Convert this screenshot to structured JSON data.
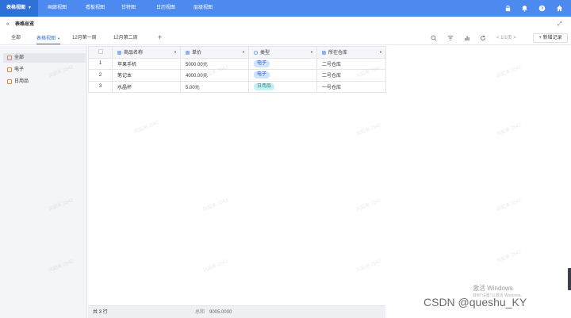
{
  "nav": {
    "items": [
      {
        "label": "表格视图",
        "active": true
      },
      {
        "label": "画廊视图",
        "active": false
      },
      {
        "label": "看板视图",
        "active": false
      },
      {
        "label": "甘特图",
        "active": false
      },
      {
        "label": "日历视图",
        "active": false
      },
      {
        "label": "层级视图",
        "active": false
      }
    ],
    "icons": [
      "lock-icon",
      "bell-icon",
      "help-icon",
      "home-icon"
    ]
  },
  "header": {
    "title": "表格总览"
  },
  "tabs": [
    {
      "label": "全部",
      "active": false
    },
    {
      "label": "表格视图",
      "active": true
    },
    {
      "label": "12月第一周",
      "active": false
    },
    {
      "label": "12月第二周",
      "active": false
    }
  ],
  "toolbar": {
    "pager": "< 1/1页 >",
    "add_record": "+ 新增记录"
  },
  "sidebar": {
    "items": [
      {
        "label": "全部",
        "active": true
      },
      {
        "label": "电子",
        "active": false
      },
      {
        "label": "日用品",
        "active": false
      }
    ]
  },
  "table": {
    "columns": [
      "商品名称",
      "单价",
      "类型",
      "所在仓库"
    ],
    "rows": [
      {
        "index": "1",
        "name": "苹果手机",
        "price": "5000.00元",
        "type": "电子",
        "warehouse": "二号仓库"
      },
      {
        "index": "2",
        "name": "笔记本",
        "price": "4000.00元",
        "type": "电子",
        "warehouse": "二号仓库"
      },
      {
        "index": "3",
        "name": "水晶杯",
        "price": "5.00元",
        "type": "日用品",
        "warehouse": "一号仓库"
      }
    ]
  },
  "footer": {
    "rows_label": "共 3 行",
    "sum_label": "总和",
    "sum_value": "9005.0000"
  },
  "overlay": {
    "activate": "激活 Windows",
    "activate_sub": "转到\"设置\"以激活 Windows。",
    "csdn": "CSDN @queshu_KY",
    "watermark": "风起来 2542"
  },
  "colors": {
    "nav_bg": "#4d8af0",
    "nav_active": "#2f6fd8",
    "tag_electronics_bg": "#cfe3fb",
    "tag_daily_bg": "#c9f0ef"
  }
}
